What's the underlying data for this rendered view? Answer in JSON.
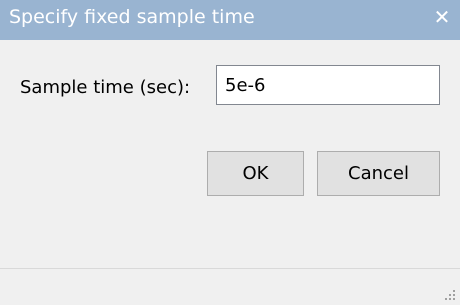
{
  "dialog": {
    "title": "Specify fixed sample time",
    "close_icon": "close-icon"
  },
  "form": {
    "label": "Sample time (sec):",
    "value": "5e-6"
  },
  "buttons": {
    "ok_label": "OK",
    "cancel_label": "Cancel"
  },
  "colors": {
    "titlebar": "#99b4d1",
    "window": "#f0f0f0",
    "button_face": "#e1e1e1"
  }
}
